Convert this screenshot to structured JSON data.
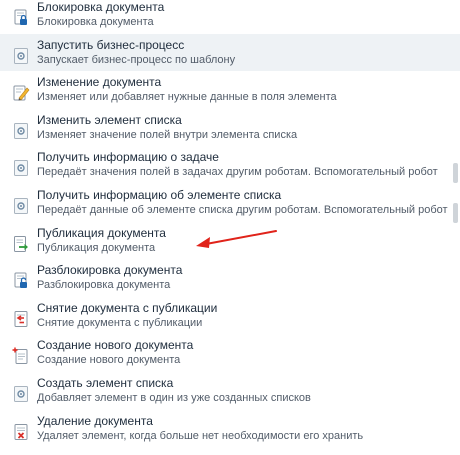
{
  "items": [
    {
      "title": "Блокировка документа",
      "desc": "Блокировка документа",
      "icon": "document-lock-icon"
    },
    {
      "title": "Запустить бизнес-процесс",
      "desc": "Запускает бизнес-процесс по шаблону",
      "icon": "gear-doc-icon"
    },
    {
      "title": "Изменение документа",
      "desc": "Изменяет или добавляет нужные данные в поля элемента",
      "icon": "document-edit-icon"
    },
    {
      "title": "Изменить элемент списка",
      "desc": "Изменяет значение полей внутри элемента списка",
      "icon": "gear-doc-icon"
    },
    {
      "title": "Получить информацию о задаче",
      "desc": "Передаёт значения полей в задачах другим роботам. Вспомогательный робот",
      "icon": "gear-doc-icon"
    },
    {
      "title": "Получить информацию об элементе списка",
      "desc": "Передаёт данные об элементе списка другим роботам. Вспомогательный робот",
      "icon": "gear-doc-icon"
    },
    {
      "title": "Публикация документа",
      "desc": "Публикация документа",
      "icon": "document-publish-icon"
    },
    {
      "title": "Разблокировка документа",
      "desc": "Разблокировка документа",
      "icon": "document-unlock-icon"
    },
    {
      "title": "Снятие документа с публикации",
      "desc": "Снятие документа с публикации",
      "icon": "document-unpublish-icon"
    },
    {
      "title": "Создание нового документа",
      "desc": "Создание нового документа",
      "icon": "document-new-icon"
    },
    {
      "title": "Создать элемент списка",
      "desc": "Добавляет элемент в один из уже созданных списков",
      "icon": "gear-doc-icon"
    },
    {
      "title": "Удаление документа",
      "desc": "Удаляет элемент, когда больше нет необходимости его хранить",
      "icon": "document-delete-icon"
    }
  ],
  "colors": {
    "title": "#1f2d3d",
    "desc": "#525c69",
    "highlight_row": "#eef2f5",
    "arrow": "#e0231a",
    "scrollbar": "#cfd4d9"
  }
}
